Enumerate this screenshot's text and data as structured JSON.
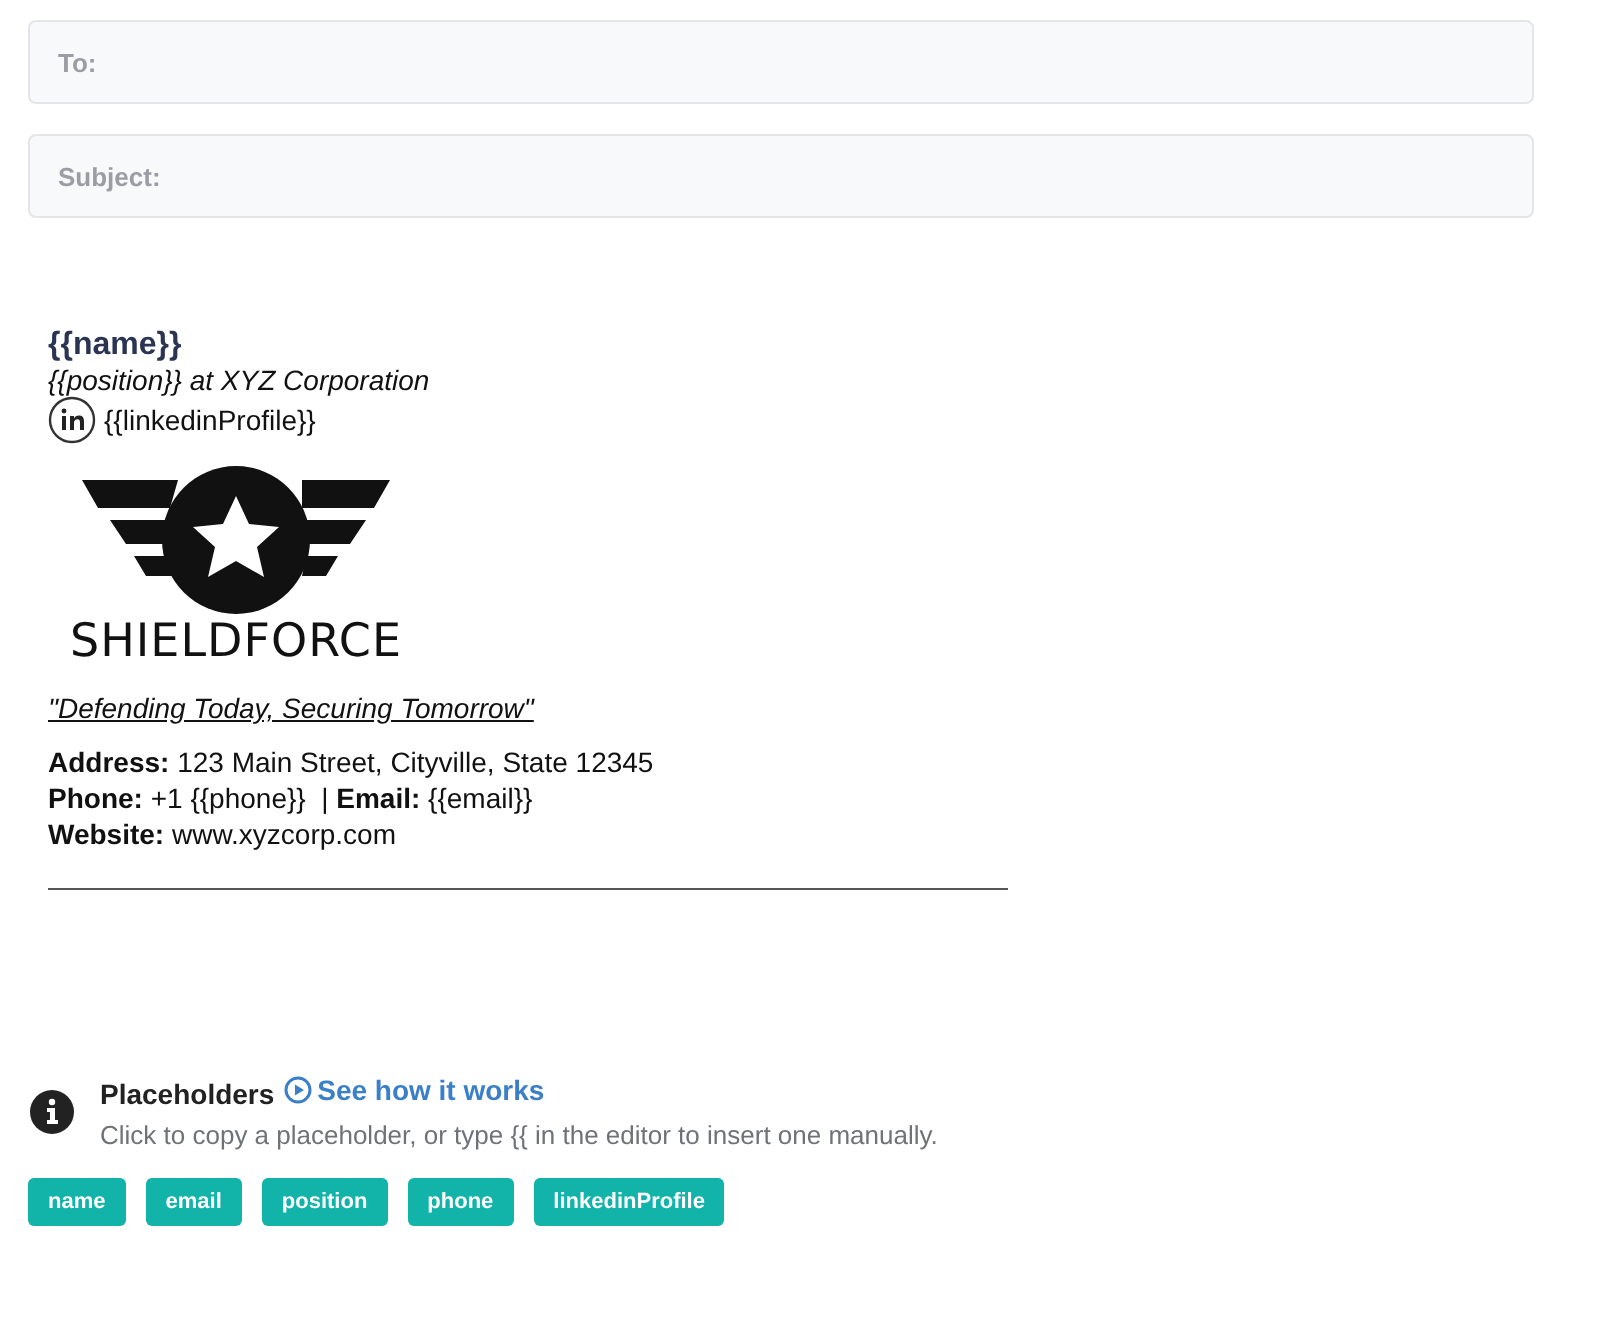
{
  "fields": [
    {
      "label": "To:"
    },
    {
      "label": "Subject:"
    }
  ],
  "signature": {
    "name": "{{name}}",
    "title": "*{{position}}* at XYZ Corporation",
    "linkedin": "{{linkedinProfile}}",
    "logo_text": "SHIELDFORCE",
    "tagline": "\"Defending Today, Securing Tomorrow\"",
    "contact_lines": [
      "**Address:** 123 Main Street, Cityville, State 12345",
      "**Phone:** +1 {{phone}}  | **Email:** {{email}}",
      "**Website:** www.xyzcorp.com"
    ]
  },
  "placeholders": {
    "title": "Placeholders",
    "link": "See how it works",
    "hint": "Click to copy a placeholder, or type {{ in the editor to insert one manually.",
    "chips": [
      "name",
      "email",
      "position",
      "phone",
      "linkedinProfile"
    ]
  }
}
